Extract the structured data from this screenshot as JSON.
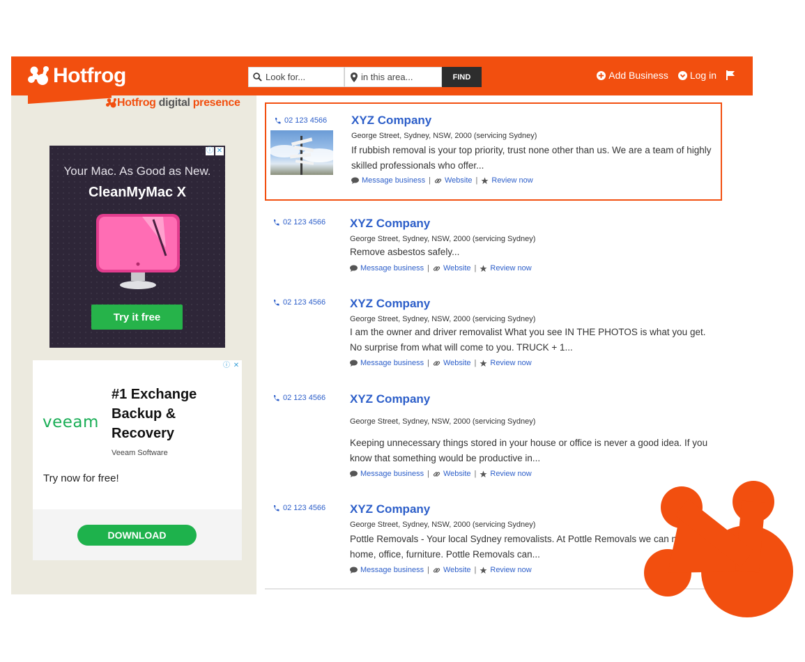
{
  "header": {
    "brand": "Hotfrog",
    "search_placeholder": "Look for...",
    "location_placeholder": "in this area...",
    "find_label": "FIND",
    "nav": {
      "add_business": "Add Business",
      "log_in": "Log in"
    },
    "accent_color": "#f24f0f"
  },
  "brand_tag": {
    "hotfrog": "Hotfrog",
    "digital": "digital",
    "presence": "presence"
  },
  "ads": {
    "cleanmymac": {
      "line1": "Your Mac. As Good as New.",
      "line2": "CleanMyMac X",
      "button": "Try it free"
    },
    "veeam": {
      "logo": "veeam",
      "title": "#1 Exchange Backup & Recovery",
      "sub": "Veeam Software",
      "cta": "Try now for free!",
      "button": "DOWNLOAD"
    }
  },
  "listings": [
    {
      "phone": "02 123 4566",
      "name": "XYZ Company",
      "address": "George Street, Sydney, NSW, 2000 (servicing Sydney)",
      "description": "If rubbish removal is your top priority, trust none other than us. We are a team of highly skilled professionals who offer...",
      "message": "Message business",
      "website": "Website",
      "review": "Review now"
    },
    {
      "phone": "02 123 4566",
      "name": "XYZ Company",
      "address": "George Street, Sydney, NSW, 2000 (servicing Sydney)",
      "description": "Remove asbestos safely...",
      "message": "Message business",
      "website": "Website",
      "review": "Review now"
    },
    {
      "phone": "02 123 4566",
      "name": "XYZ Company",
      "address": "George Street, Sydney, NSW, 2000 (servicing Sydney)",
      "description": "I am the owner and driver removalist What you see IN THE PHOTOS is what you get. No surprise from what will come to you. TRUCK + 1...",
      "message": "Message business",
      "website": "Website",
      "review": "Review now"
    },
    {
      "phone": "02 123 4566",
      "name": "XYZ Company",
      "address": "George Street, Sydney, NSW, 2000 (servicing Sydney)",
      "description": "Keeping unnecessary things stored in your house or office is never a good idea. If you know that something would be productive in...",
      "message": "Message business",
      "website": "Website",
      "review": "Review now"
    },
    {
      "phone": "02 123 4566",
      "name": "XYZ Company",
      "address": "George Street, Sydney, NSW, 2000 (servicing Sydney)",
      "description": "Pottle Removals - Your local Sydney removalists. At Pottle Removals we can move your home, office, furniture. Pottle Removals can...",
      "message": "Message business",
      "website": "Website",
      "review": "Review now"
    }
  ]
}
